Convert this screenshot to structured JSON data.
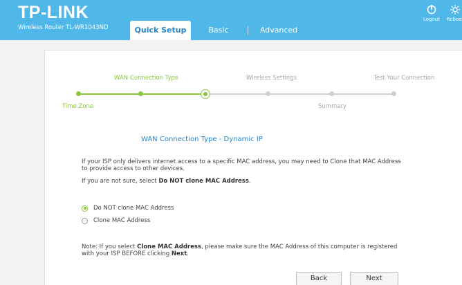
{
  "header": {
    "logo": "TP-LINK",
    "model": "Wireless Router TL-WR1043ND",
    "tabs": [
      {
        "label": "Quick Setup",
        "active": true
      },
      {
        "label": "Basic",
        "active": false
      },
      {
        "label": "Advanced",
        "active": false
      }
    ],
    "logout_label": "Logout",
    "reboot_label": "Reboot",
    "bg_color": "#4fb8e8"
  },
  "stepper": {
    "steps": [
      {
        "label": "Time Zone",
        "state": "done"
      },
      {
        "label": "WAN Connection Type",
        "state": "done"
      },
      {
        "label": "",
        "state": "current"
      },
      {
        "label": "Wireless Settings",
        "state": "todo"
      },
      {
        "label": "Summary",
        "state": "todo"
      },
      {
        "label": "Test Your Connection",
        "state": "todo"
      }
    ],
    "done_color": "#8cc63f",
    "todo_color": "#c8c8c8"
  },
  "content": {
    "section_title": "WAN Connection Type - Dynamic IP",
    "para1_line1": "If your ISP only delivers internet access to a specific MAC address, you may need to Clone that MAC Address",
    "para1_line2": "to provide access to other devices.",
    "para2_prefix": "If you are not sure, select ",
    "para2_bold": "Do NOT clone MAC Address",
    "para2_suffix": ".",
    "options": [
      {
        "label": "Do NOT clone MAC Address",
        "checked": true
      },
      {
        "label": "Clone MAC Address",
        "checked": false
      }
    ],
    "note_prefix": "Note: If you select ",
    "note_bold1": "Clone MAC Address",
    "note_mid": ", please make sure the MAC Address of this computer is registered",
    "note_line2_prefix": "with your ISP BEFORE clicking ",
    "note_bold2": "Next",
    "note_suffix": "."
  },
  "buttons": {
    "back": "Back",
    "next": "Next"
  }
}
